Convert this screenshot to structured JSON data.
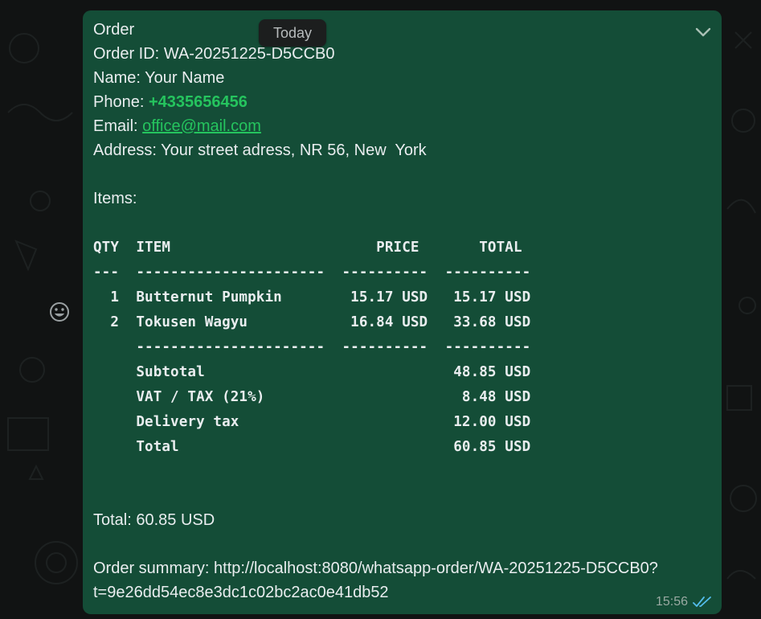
{
  "date_divider": "Today",
  "message": {
    "heading": "Order",
    "order_id_label": "Order ID:",
    "order_id": "WA-20251225-D5CCB0",
    "name_label": "Name:",
    "name": "Your Name",
    "phone_label": "Phone:",
    "phone": "+4335656456",
    "email_label": "Email:",
    "email": "office@mail.com",
    "address_label": "Address:",
    "address": "Your street adress, NR 56, New  York",
    "items_label": "Items:",
    "receipt_lines": [
      "QTY  ITEM                        PRICE       TOTAL",
      "---  ----------------------  ----------  ----------",
      "  1  Butternut Pumpkin        15.17 USD   15.17 USD",
      "  2  Tokusen Wagyu            16.84 USD   33.68 USD",
      "     ----------------------  ----------  ----------",
      "     Subtotal                             48.85 USD",
      "     VAT / TAX (21%)                       8.48 USD",
      "     Delivery tax                         12.00 USD",
      "     Total                                60.85 USD"
    ],
    "total_line": "Total: 60.85 USD",
    "summary_line_1": "Order summary: http://localhost:8080/whatsapp-order/WA-20251225-D5CCB0?",
    "summary_line_2": "t=9e26dd54ec8e3dc1c02bc2ac0e41db52",
    "time": "15:56",
    "status_icon": "double-check-read-icon"
  },
  "colors": {
    "bubble": "#144d37",
    "accent_green": "#25c45e",
    "read_tick": "#53bdeb",
    "background": "#111313"
  }
}
